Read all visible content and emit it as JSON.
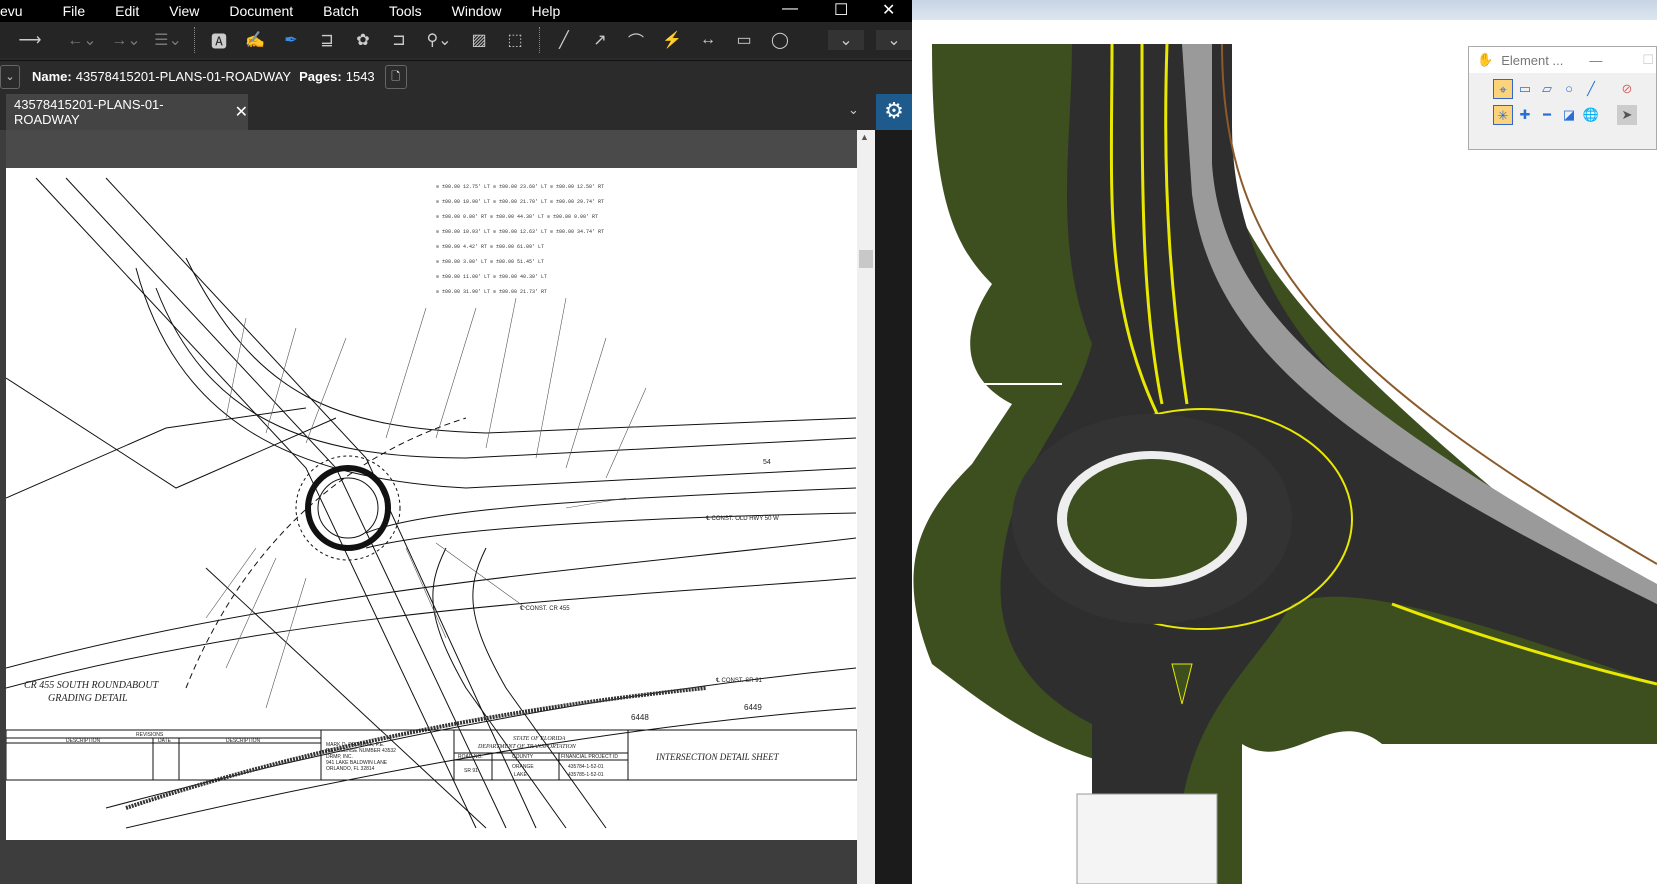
{
  "app": {
    "menu": [
      "evu",
      "File",
      "Edit",
      "View",
      "Document",
      "Batch",
      "Tools",
      "Window",
      "Help"
    ]
  },
  "namebar": {
    "name_label": "Name:",
    "name_value": "43578415201-PLANS-01-ROADWAY",
    "pages_label": "Pages:",
    "pages_value": "1543"
  },
  "tabs": [
    {
      "label": "43578415201-PLANS-01-ROADWAY"
    }
  ],
  "toolbar_icons": [
    "arrow-line-icon",
    "back-icon",
    "forward-icon",
    "lines-icon",
    "text-box-icon",
    "highlighter-icon",
    "pen-icon",
    "callout-icon",
    "cloud-icon",
    "polyline-callout-icon",
    "stamp-icon",
    "image-icon",
    "crop-icon",
    "line-icon",
    "arrow-icon",
    "arc-icon",
    "polyline-icon",
    "dimension-icon",
    "rectangle-icon",
    "ellipse-icon"
  ],
  "drawing": {
    "title_line1": "CR 455 SOUTH ROUNDABOUT",
    "title_line2": "GRADING DETAIL",
    "revisions": "REVISIONS",
    "col_description": "DESCRIPTION",
    "col_date": "DATE",
    "engineer": [
      "MARK D. PROCHAK, P.E.",
      "P.E. LICENSE NUMBER 43532",
      "DRMP, INC.",
      "941 LAKE BALDWIN LANE",
      "ORLANDO, FL 32814"
    ],
    "state": "STATE OF FLORIDA",
    "dept": "DEPARTMENT OF TRANSPORTATION",
    "road_no_label": "ROAD NO.",
    "county_label": "COUNTY",
    "fin_label": "FINANCIAL PROJECT ID",
    "road_no": "SR 91",
    "county1": "ORANGE",
    "county2": "LAKE",
    "fin1": "435784-1-52-01",
    "fin2": "435785-1-52-01",
    "sheet_title": "INTERSECTION DETAIL SHEET",
    "labels": {
      "const_cr455": "℄ CONST. CR 455",
      "const_sr91": "℄ CONST. SR 91",
      "const_old": "℄ CONST. OLD HWY 50 W",
      "sta1": "6448",
      "sta2": "6449",
      "sta3": "54"
    }
  },
  "element_panel": {
    "title": "Element ..."
  },
  "colors": {
    "accent": "#1e5a8c",
    "terrain": "#3d4f1f",
    "road": "#2e2e2e",
    "edge": "#e8e800"
  }
}
